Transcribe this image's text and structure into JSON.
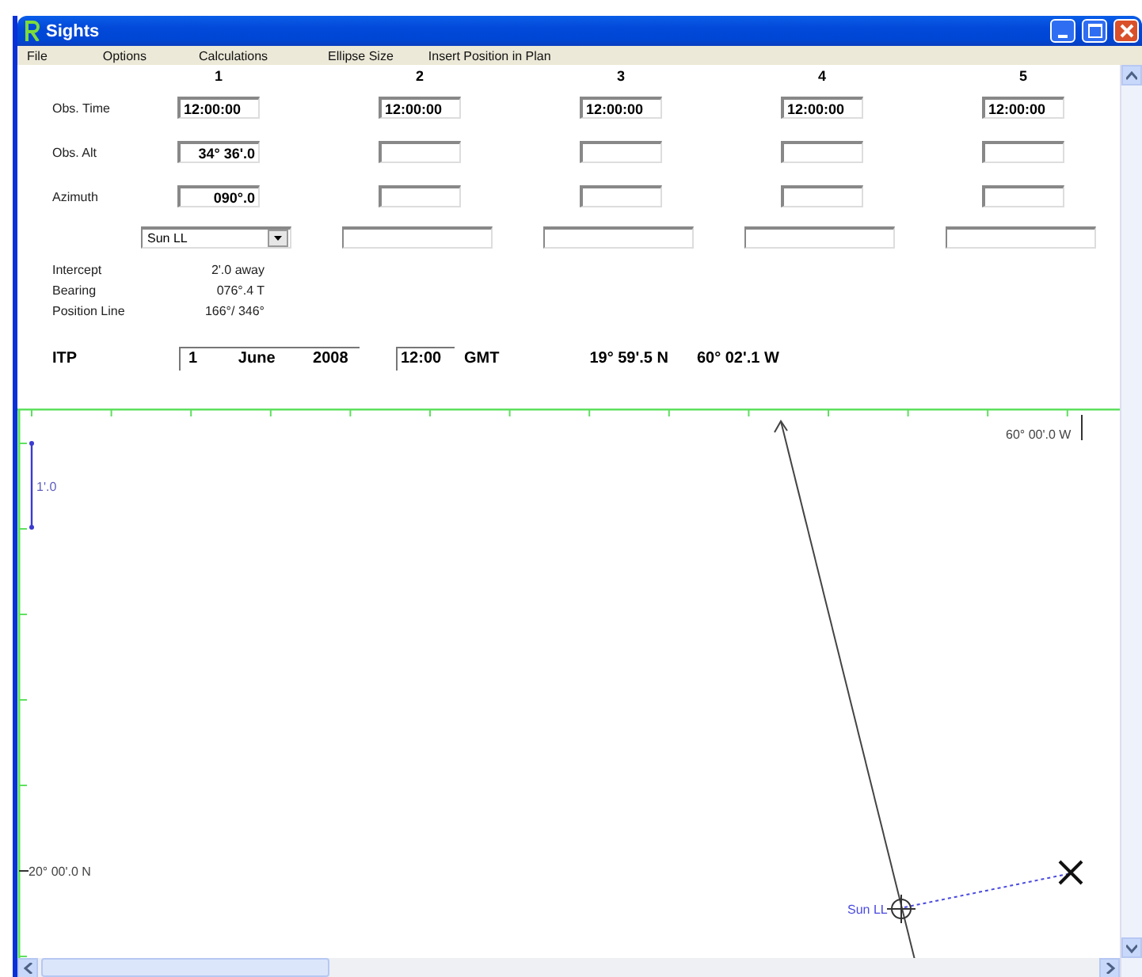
{
  "window": {
    "title": "Sights"
  },
  "menu": [
    "File",
    "Options",
    "Calculations",
    "Ellipse Size",
    "Insert Position in Plan"
  ],
  "row_labels": {
    "obs_time": "Obs. Time",
    "obs_alt": "Obs. Alt",
    "azimuth": "Azimuth"
  },
  "columns": [
    {
      "number": "1",
      "obs_time": "12:00:00",
      "obs_alt": "34° 36'.0",
      "azimuth": "090°.0",
      "body": "Sun LL"
    },
    {
      "number": "2",
      "obs_time": "12:00:00"
    },
    {
      "number": "3",
      "obs_time": "12:00:00"
    },
    {
      "number": "4",
      "obs_time": "12:00:00"
    },
    {
      "number": "5",
      "obs_time": "12:00:00"
    }
  ],
  "results": [
    {
      "label": "Intercept",
      "value": "2'.0 away"
    },
    {
      "label": "Bearing",
      "value": "076°.4 T"
    },
    {
      "label": "Position Line",
      "value": "166°/ 346°"
    }
  ],
  "itp": {
    "label": "ITP",
    "day": "1",
    "month": "June",
    "year": "2008",
    "time": "12:00",
    "zone": "GMT",
    "latitude": "19° 59'.5 N",
    "longitude": "60° 02'.1 W"
  },
  "plot": {
    "longitude_label": "60° 00'.0 W",
    "scale_label": "1'.0",
    "latitude_label": "20° 00'.0 N",
    "sight_label": "Sun LL"
  }
}
